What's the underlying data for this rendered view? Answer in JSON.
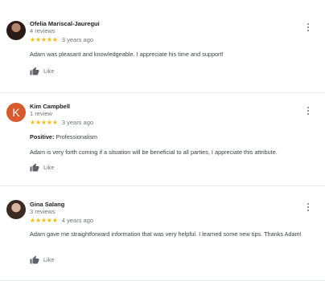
{
  "reviews": [
    {
      "author": "Ofelia Mariscal-Jauregui",
      "review_count": "4 reviews",
      "stars": "★★★★★",
      "date": "3 years ago",
      "text": "Adam was pleasant and knowledgeable. I appreciate his time and support!",
      "like_label": "Like"
    },
    {
      "author": "Kim Campbell",
      "avatar_letter": "K",
      "review_count": "1 review",
      "stars": "★★★★★",
      "date": "3 years ago",
      "positive_label": "Positive:",
      "positive_value": "Professionalism",
      "text": "Adam is very forth coming if a situation will be beneficial to all parties, I appreciate this attribute.",
      "like_label": "Like"
    },
    {
      "author": "Gina Salang",
      "review_count": "3 reviews",
      "stars": "★★★★★",
      "date": "4 years ago",
      "text": "Adam gave me straightforward information that was very helpful. I learned some new tips. Thanks Adam!",
      "like_label": "Like"
    }
  ],
  "colors": {
    "star": "#fbbc04",
    "avatar_k": "#d85a2d",
    "divider": "#e8eaed"
  },
  "rating": 5,
  "icons": [
    "thumb-up-icon",
    "more-vert-icon"
  ]
}
